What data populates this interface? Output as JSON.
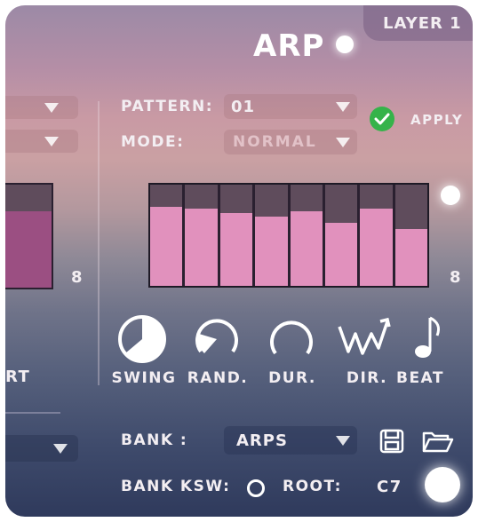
{
  "header": {
    "title": "ARP",
    "layer_label": "LAYER 1"
  },
  "arp": {
    "pattern_label": "PATTERN:",
    "pattern_value": "01",
    "mode_label": "MODE:",
    "mode_value": "NORMAL",
    "apply_label": "APPLY",
    "step_count": "8",
    "steps": [
      0.78,
      0.76,
      0.72,
      0.68,
      0.74,
      0.62,
      0.76,
      0.56
    ],
    "controls": [
      {
        "label": "SWING",
        "icon": "swing-knob-icon"
      },
      {
        "label": "RAND.",
        "icon": "random-knob-icon"
      },
      {
        "label": "DUR.",
        "icon": "duration-knob-icon"
      },
      {
        "label": "DIR.",
        "icon": "direction-icon"
      },
      {
        "label": "BEAT",
        "icon": "note-icon"
      }
    ]
  },
  "left_panel": {
    "step_count": "8",
    "label_fragment": "RT"
  },
  "bank": {
    "bank_label": "BANK :",
    "bank_value": "ARPS",
    "bank_ksw_label": "BANK KSW:",
    "root_label": "ROOT:",
    "root_value": "C7"
  },
  "colors": {
    "bar": "#e191bd",
    "apply": "#35b34a",
    "left_bar": "#9b4f82"
  }
}
